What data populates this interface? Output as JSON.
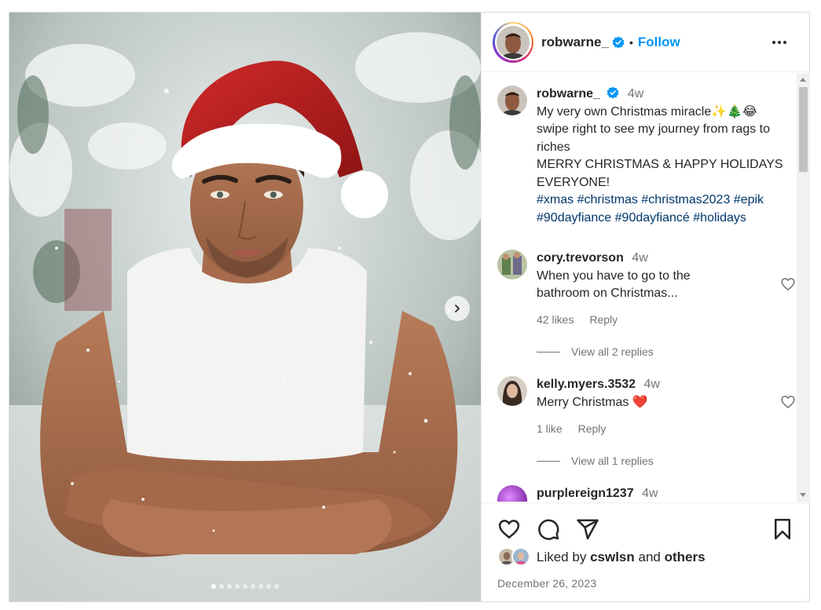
{
  "post": {
    "username": "robwarne_",
    "separator": "•",
    "follow_label": "Follow",
    "more_icon": "more-horizontal-icon",
    "carousel": {
      "slide_count": 9,
      "active_slide": 1
    },
    "caption": {
      "username": "robwarne_",
      "time": "4w",
      "line1": "My very own Christmas miracle✨🎄😂",
      "line2": "swipe right to see my journey from rags to riches",
      "line3": "MERRY CHRISTMAS & HAPPY HOLIDAYS EVERYONE!",
      "hashtags": [
        "#xmas",
        "#christmas",
        "#christmas2023",
        "#epik",
        "#90dayfiance",
        "#90dayfiancé",
        "#holidays"
      ]
    }
  },
  "comments": [
    {
      "username": "cory.trevorson",
      "time": "4w",
      "text": "When you have to go to the bathroom on Christmas...",
      "likes": "42 likes",
      "reply": "Reply",
      "view_replies": "View all 2 replies"
    },
    {
      "username": "kelly.myers.3532",
      "time": "4w",
      "text": "Merry Christmas ❤️",
      "likes": "1 like",
      "reply": "Reply",
      "view_replies": "View all 1 replies"
    },
    {
      "username": "purplereign1237",
      "time": "4w"
    }
  ],
  "footer": {
    "liked_prefix": "Liked by",
    "liked_user": "cswlsn",
    "liked_and": "and",
    "liked_others": "others",
    "date": "December 26, 2023"
  },
  "colors": {
    "accent": "#0095f6",
    "hashtag": "#00376b",
    "muted": "#737373",
    "heart": "#ed4956"
  }
}
